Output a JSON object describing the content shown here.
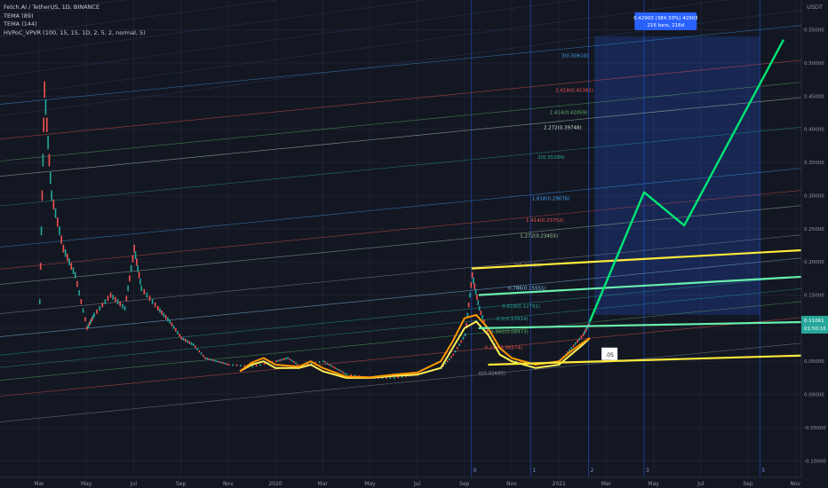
{
  "header": {
    "symbol": "Fetch.AI / TetherUS, 1D, BINANCE",
    "indicators": [
      "TEMA (89)",
      "TEMA (144)",
      "HVPoC_VPVR (100, 15, 15, 1D, 2, 5, 2, normal, 5)"
    ],
    "currency": "USDT"
  },
  "price_badge": {
    "price": "0.11061",
    "countdown": "01:50:16",
    "color": "#26a69a"
  },
  "measure_box": {
    "line1": "0.42903 (384.33%) 42903",
    "line2": "216 bars, 216d",
    "color": "#2962ff"
  },
  "volume_box": {
    "label": ".05"
  },
  "colors": {
    "background": "#131722",
    "up": "#26a69a",
    "down": "#ef5350",
    "tema89": "#ffee58",
    "tema144": "#ff9800",
    "projection": "#00e676",
    "channel": "#ffeb3b",
    "fib_blue": "#2962ff"
  },
  "fib_levels": [
    {
      "label": "0(0.02695)",
      "color": "#9598a1"
    },
    {
      "label": "0.236(0.06574)",
      "color": "#ef5350"
    },
    {
      "label": "0.382(0.08973)",
      "color": "#66bb6a"
    },
    {
      "label": "0.5(0.10914)",
      "color": "#26a69a"
    },
    {
      "label": "0.618(0.12791)",
      "color": "#26a69a"
    },
    {
      "label": "0.786(0.15551)",
      "color": "#90caf9"
    },
    {
      "label": "1(0.19030)",
      "color": "#9598a1"
    },
    {
      "label": "1.272(0.23455)",
      "color": "#a5d6a7"
    },
    {
      "label": "1.414(0.25752)",
      "color": "#ef5350"
    },
    {
      "label": "1.618(0.29076)",
      "color": "#42a5f5"
    },
    {
      "label": "2(0.35284)",
      "color": "#26a69a"
    },
    {
      "label": "2.272(0.39748)",
      "color": "#c8e6c9"
    },
    {
      "label": "2.414(0.42059)",
      "color": "#66bb6a"
    },
    {
      "label": "2.618(0.45381)",
      "color": "#ef5350"
    },
    {
      "label": "3(0.50610)",
      "color": "#42a5f5"
    }
  ],
  "chart_data": {
    "type": "line",
    "xlabels": [
      "Mar",
      "May",
      "Jul",
      "Sep",
      "Nov",
      "2020",
      "Mar",
      "May",
      "Jul",
      "Sep",
      "Nov",
      "2021",
      "Mar",
      "May",
      "Jul",
      "Sep",
      "Nov"
    ],
    "yticks": [
      "0.55000",
      "0.50000",
      "0.45000",
      "0.40000",
      "0.35000",
      "0.30000",
      "0.25000",
      "0.20000",
      "0.15000",
      "0.10000",
      "0.05000",
      "0.00000",
      "-0.05000",
      "-0.10000"
    ],
    "ylim": [
      -0.125,
      0.595
    ],
    "xrange_months": [
      0,
      33
    ],
    "cycle_labels": [
      "0",
      "1",
      "2",
      "3",
      "5"
    ],
    "series": [
      {
        "values_type": "price",
        "points": [
          [
            0,
            0.14
          ],
          [
            0.2,
            0.46
          ],
          [
            0.5,
            0.3
          ],
          [
            1,
            0.22
          ],
          [
            1.5,
            0.18
          ],
          [
            2,
            0.1
          ],
          [
            2.3,
            0.12
          ],
          [
            3,
            0.15
          ],
          [
            3.6,
            0.13
          ],
          [
            4,
            0.22
          ],
          [
            4.3,
            0.16
          ],
          [
            5,
            0.13
          ],
          [
            5.5,
            0.11
          ],
          [
            6,
            0.085
          ],
          [
            6.5,
            0.075
          ],
          [
            7,
            0.055
          ],
          [
            7.5,
            0.05
          ],
          [
            8,
            0.045
          ],
          [
            9,
            0.042
          ],
          [
            10,
            0.05
          ],
          [
            10.5,
            0.055
          ],
          [
            11,
            0.043
          ],
          [
            12,
            0.05
          ],
          [
            12.5,
            0.04
          ],
          [
            13,
            0.03
          ],
          [
            14,
            0.025
          ],
          [
            15,
            0.025
          ],
          [
            16,
            0.03
          ],
          [
            17,
            0.04
          ],
          [
            17.5,
            0.06
          ],
          [
            18,
            0.09
          ],
          [
            18.3,
            0.18
          ],
          [
            18.6,
            0.13
          ],
          [
            19,
            0.09
          ],
          [
            19.5,
            0.06
          ],
          [
            20,
            0.05
          ],
          [
            21,
            0.045
          ],
          [
            22,
            0.05
          ],
          [
            22.5,
            0.07
          ],
          [
            23,
            0.09
          ],
          [
            23.3,
            0.11
          ]
        ]
      },
      {
        "name": "",
        "values_type": "tema89",
        "points": [
          [
            8.5,
            0.035
          ],
          [
            9,
            0.045
          ],
          [
            9.5,
            0.05
          ],
          [
            10,
            0.04
          ],
          [
            11,
            0.04
          ],
          [
            11.5,
            0.045
          ],
          [
            12,
            0.035
          ],
          [
            13,
            0.025
          ],
          [
            14,
            0.025
          ],
          [
            15,
            0.028
          ],
          [
            16,
            0.03
          ],
          [
            17,
            0.04
          ],
          [
            17.5,
            0.07
          ],
          [
            18,
            0.1
          ],
          [
            18.5,
            0.11
          ],
          [
            19,
            0.09
          ],
          [
            19.5,
            0.06
          ],
          [
            20,
            0.05
          ],
          [
            21,
            0.04
          ],
          [
            22,
            0.045
          ],
          [
            22.5,
            0.06
          ],
          [
            23,
            0.075
          ],
          [
            23.3,
            0.085
          ]
        ]
      },
      {
        "name": "",
        "values_type": "tema144",
        "points": [
          [
            8.5,
            0.035
          ],
          [
            9,
            0.048
          ],
          [
            9.5,
            0.055
          ],
          [
            10,
            0.045
          ],
          [
            11,
            0.042
          ],
          [
            11.5,
            0.05
          ],
          [
            12,
            0.04
          ],
          [
            13,
            0.027
          ],
          [
            14,
            0.026
          ],
          [
            15,
            0.03
          ],
          [
            16,
            0.033
          ],
          [
            17,
            0.05
          ],
          [
            17.5,
            0.08
          ],
          [
            18,
            0.115
          ],
          [
            18.5,
            0.12
          ],
          [
            19,
            0.1
          ],
          [
            19.5,
            0.07
          ],
          [
            20,
            0.055
          ],
          [
            21,
            0.045
          ],
          [
            22,
            0.05
          ],
          [
            22.5,
            0.065
          ],
          [
            23,
            0.078
          ],
          [
            23.3,
            0.085
          ]
        ]
      },
      {
        "name": "",
        "values_type": "projection",
        "points": [
          [
            23.3,
            0.11
          ],
          [
            25.6,
            0.305
          ],
          [
            27.3,
            0.255
          ],
          [
            31.5,
            0.535
          ]
        ]
      }
    ],
    "channel_lines": [
      {
        "from": [
          18.3,
          0.19
        ],
        "to": [
          33,
          0.22
        ]
      },
      {
        "from": [
          18.6,
          0.15
        ],
        "to": [
          33,
          0.18
        ]
      },
      {
        "from": [
          18.6,
          0.1
        ],
        "to": [
          33,
          0.11
        ]
      },
      {
        "from": [
          19,
          0.045
        ],
        "to": [
          33,
          0.06
        ]
      }
    ]
  }
}
